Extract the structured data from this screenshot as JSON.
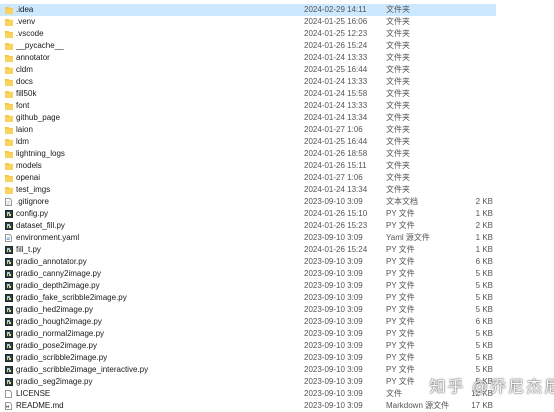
{
  "colors": {
    "folder": "#f4c542",
    "selected_row": "#cce8ff",
    "python": "#3a3a3a"
  },
  "files": [
    {
      "name": ".idea",
      "date": "2024-02-29 14:11",
      "type": "文件夹",
      "size": "",
      "icon": "folder-icon",
      "selected": true
    },
    {
      "name": ".venv",
      "date": "2024-01-25 16:06",
      "type": "文件夹",
      "size": "",
      "icon": "folder-icon"
    },
    {
      "name": ".vscode",
      "date": "2024-01-25 12:23",
      "type": "文件夹",
      "size": "",
      "icon": "folder-icon"
    },
    {
      "name": "__pycache__",
      "date": "2024-01-26 15:24",
      "type": "文件夹",
      "size": "",
      "icon": "folder-icon"
    },
    {
      "name": "annotator",
      "date": "2024-01-24 13:33",
      "type": "文件夹",
      "size": "",
      "icon": "folder-icon"
    },
    {
      "name": "cldm",
      "date": "2024-01-25 16:44",
      "type": "文件夹",
      "size": "",
      "icon": "folder-icon"
    },
    {
      "name": "docs",
      "date": "2024-01-24 13:33",
      "type": "文件夹",
      "size": "",
      "icon": "folder-icon"
    },
    {
      "name": "fill50k",
      "date": "2024-01-24 15:58",
      "type": "文件夹",
      "size": "",
      "icon": "folder-icon"
    },
    {
      "name": "font",
      "date": "2024-01-24 13:33",
      "type": "文件夹",
      "size": "",
      "icon": "folder-icon"
    },
    {
      "name": "github_page",
      "date": "2024-01-24 13:34",
      "type": "文件夹",
      "size": "",
      "icon": "folder-icon"
    },
    {
      "name": "laion",
      "date": "2024-01-27 1:06",
      "type": "文件夹",
      "size": "",
      "icon": "folder-icon"
    },
    {
      "name": "ldm",
      "date": "2024-01-25 16:44",
      "type": "文件夹",
      "size": "",
      "icon": "folder-icon"
    },
    {
      "name": "lightning_logs",
      "date": "2024-01-26 18:58",
      "type": "文件夹",
      "size": "",
      "icon": "folder-icon"
    },
    {
      "name": "models",
      "date": "2024-01-26 15:11",
      "type": "文件夹",
      "size": "",
      "icon": "folder-icon"
    },
    {
      "name": "openai",
      "date": "2024-01-27 1:06",
      "type": "文件夹",
      "size": "",
      "icon": "folder-icon"
    },
    {
      "name": "test_imgs",
      "date": "2024-01-24 13:34",
      "type": "文件夹",
      "size": "",
      "icon": "folder-icon"
    },
    {
      "name": ".gitignore",
      "date": "2023-09-10 3:09",
      "type": "文本文档",
      "size": "2 KB",
      "icon": "text-file-icon"
    },
    {
      "name": "config.py",
      "date": "2024-01-26 15:10",
      "type": "PY 文件",
      "size": "1 KB",
      "icon": "python-file-icon"
    },
    {
      "name": "dataset_fill.py",
      "date": "2024-01-26 15:23",
      "type": "PY 文件",
      "size": "2 KB",
      "icon": "python-file-icon"
    },
    {
      "name": "environment.yaml",
      "date": "2023-09-10 3:09",
      "type": "Yaml 源文件",
      "size": "1 KB",
      "icon": "yaml-file-icon"
    },
    {
      "name": "fill_t.py",
      "date": "2024-01-26 15:24",
      "type": "PY 文件",
      "size": "1 KB",
      "icon": "python-file-icon"
    },
    {
      "name": "gradio_annotator.py",
      "date": "2023-09-10 3:09",
      "type": "PY 文件",
      "size": "6 KB",
      "icon": "python-file-icon"
    },
    {
      "name": "gradio_canny2image.py",
      "date": "2023-09-10 3:09",
      "type": "PY 文件",
      "size": "5 KB",
      "icon": "python-file-icon"
    },
    {
      "name": "gradio_depth2image.py",
      "date": "2023-09-10 3:09",
      "type": "PY 文件",
      "size": "5 KB",
      "icon": "python-file-icon"
    },
    {
      "name": "gradio_fake_scribble2image.py",
      "date": "2023-09-10 3:09",
      "type": "PY 文件",
      "size": "5 KB",
      "icon": "python-file-icon"
    },
    {
      "name": "gradio_hed2image.py",
      "date": "2023-09-10 3:09",
      "type": "PY 文件",
      "size": "5 KB",
      "icon": "python-file-icon"
    },
    {
      "name": "gradio_hough2image.py",
      "date": "2023-09-10 3:09",
      "type": "PY 文件",
      "size": "6 KB",
      "icon": "python-file-icon"
    },
    {
      "name": "gradio_normal2image.py",
      "date": "2023-09-10 3:09",
      "type": "PY 文件",
      "size": "5 KB",
      "icon": "python-file-icon"
    },
    {
      "name": "gradio_pose2image.py",
      "date": "2023-09-10 3:09",
      "type": "PY 文件",
      "size": "5 KB",
      "icon": "python-file-icon"
    },
    {
      "name": "gradio_scribble2image.py",
      "date": "2023-09-10 3:09",
      "type": "PY 文件",
      "size": "5 KB",
      "icon": "python-file-icon"
    },
    {
      "name": "gradio_scribble2image_interactive.py",
      "date": "2023-09-10 3:09",
      "type": "PY 文件",
      "size": "5 KB",
      "icon": "python-file-icon"
    },
    {
      "name": "gradio_seg2image.py",
      "date": "2023-09-10 3:09",
      "type": "PY 文件",
      "size": "5 KB",
      "icon": "python-file-icon"
    },
    {
      "name": "LICENSE",
      "date": "2023-09-10 3:09",
      "type": "文件",
      "size": "12 KB",
      "icon": "blank-file-icon"
    },
    {
      "name": "README.md",
      "date": "2023-09-10 3:09",
      "type": "Markdown 源文件",
      "size": "17 KB",
      "icon": "markdown-file-icon"
    }
  ],
  "watermark": {
    "text": "知乎 @乔尼杰尼"
  }
}
